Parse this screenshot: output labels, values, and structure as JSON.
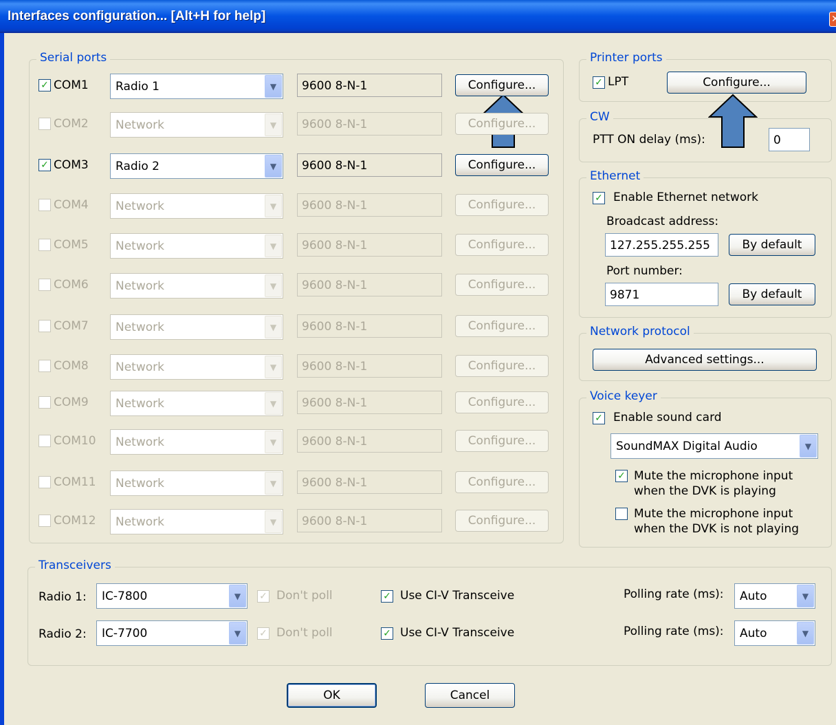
{
  "window": {
    "title": "Interfaces configuration... [Alt+H for help]"
  },
  "serial_ports": {
    "label": "Serial ports",
    "rows": [
      {
        "port": "COM1",
        "checked": true,
        "device": "Radio 1",
        "settings": "9600 8-N-1",
        "button": "Configure..."
      },
      {
        "port": "COM2",
        "checked": false,
        "device": "Network",
        "settings": "9600 8-N-1",
        "button": "Configure..."
      },
      {
        "port": "COM3",
        "checked": true,
        "device": "Radio 2",
        "settings": "9600 8-N-1",
        "button": "Configure..."
      },
      {
        "port": "COM4",
        "checked": false,
        "device": "Network",
        "settings": "9600 8-N-1",
        "button": "Configure..."
      },
      {
        "port": "COM5",
        "checked": false,
        "device": "Network",
        "settings": "9600 8-N-1",
        "button": "Configure..."
      },
      {
        "port": "COM6",
        "checked": false,
        "device": "Network",
        "settings": "9600 8-N-1",
        "button": "Configure..."
      },
      {
        "port": "COM7",
        "checked": false,
        "device": "Network",
        "settings": "9600 8-N-1",
        "button": "Configure..."
      },
      {
        "port": "COM8",
        "checked": false,
        "device": "Network",
        "settings": "9600 8-N-1",
        "button": "Configure..."
      },
      {
        "port": "COM9",
        "checked": false,
        "device": "Network",
        "settings": "9600 8-N-1",
        "button": "Configure..."
      },
      {
        "port": "COM10",
        "checked": false,
        "device": "Network",
        "settings": "9600 8-N-1",
        "button": "Configure..."
      },
      {
        "port": "COM11",
        "checked": false,
        "device": "Network",
        "settings": "9600 8-N-1",
        "button": "Configure..."
      },
      {
        "port": "COM12",
        "checked": false,
        "device": "Network",
        "settings": "9600 8-N-1",
        "button": "Configure..."
      }
    ]
  },
  "printer_ports": {
    "label": "Printer ports",
    "lpt_label": "LPT",
    "lpt_checked": true,
    "configure_label": "Configure..."
  },
  "cw": {
    "label": "CW",
    "ptt_label": "PTT ON delay (ms):",
    "ptt_value": "0"
  },
  "ethernet": {
    "label": "Ethernet",
    "enable_label": "Enable Ethernet network",
    "enable_checked": true,
    "broadcast_label": "Broadcast address:",
    "broadcast_value": "127.255.255.255",
    "by_default_label": "By default",
    "port_label": "Port number:",
    "port_value": "9871"
  },
  "network_protocol": {
    "label": "Network protocol",
    "advanced_label": "Advanced settings..."
  },
  "voice_keyer": {
    "label": "Voice keyer",
    "enable_label": "Enable sound card",
    "enable_checked": true,
    "device": "SoundMAX Digital Audio",
    "mute_playing_line1": "Mute the microphone input",
    "mute_playing_line2": "when the DVK is playing",
    "mute_playing_checked": true,
    "mute_not_playing_line1": "Mute the microphone input",
    "mute_not_playing_line2": "when the DVK is not playing",
    "mute_not_playing_checked": false
  },
  "transceivers": {
    "label": "Transceivers",
    "rows": [
      {
        "label": "Radio 1:",
        "model": "IC-7800",
        "dont_poll": "Don't poll",
        "civ": "Use CI-V Transceive",
        "polling_label": "Polling rate (ms):",
        "polling": "Auto"
      },
      {
        "label": "Radio 2:",
        "model": "IC-7700",
        "dont_poll": "Don't poll",
        "civ": "Use CI-V Transceive",
        "polling_label": "Polling rate (ms):",
        "polling": "Auto"
      }
    ]
  },
  "buttons": {
    "ok": "OK",
    "cancel": "Cancel"
  },
  "annotations": {
    "arrow_color": "#4F81BD"
  }
}
